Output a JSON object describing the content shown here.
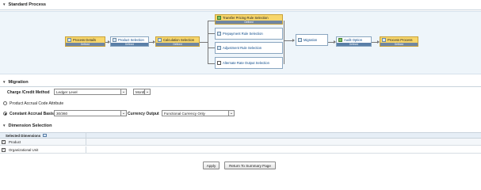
{
  "sections": {
    "standard_process": "Standard Process",
    "migration": "Migration",
    "dimension_selection": "Dimension Selection"
  },
  "flow": {
    "nodes": [
      {
        "label": "Process Details",
        "sub": "Defined"
      },
      {
        "label": "Product Selection",
        "sub": "Defined"
      },
      {
        "label": "Calculation Selection",
        "sub": "Defined"
      },
      {
        "label": "Transfer Pricing Rule Selection",
        "sub": "Defined"
      },
      {
        "label": "Prepayment Rule Selection",
        "sub": ""
      },
      {
        "label": "Adjustment Rule Selection",
        "sub": ""
      },
      {
        "label": "Alternate Rate Output Selection",
        "sub": ""
      },
      {
        "label": "Migration",
        "sub": ""
      },
      {
        "label": "Audit Option",
        "sub": "Defined"
      },
      {
        "label": "Process Process",
        "sub": "Defined"
      }
    ]
  },
  "migration": {
    "charge_label": "Charge /Credit Method",
    "charge_value": "Ledger Level",
    "freq_value": "Monthly",
    "product_accrual_label": "Product Accrual Code Attribute",
    "constant_accrual_label": "Constant Accrual Basis",
    "constant_accrual_value": "30/360",
    "currency_label": "Currency Output",
    "currency_value": "Functional Currency Only"
  },
  "table": {
    "header": "Selected Dimensions",
    "rows": [
      {
        "label": "Product"
      },
      {
        "label": "Organizational Unit"
      }
    ]
  },
  "buttons": {
    "apply": "Apply",
    "return": "Return To Summary Page"
  }
}
